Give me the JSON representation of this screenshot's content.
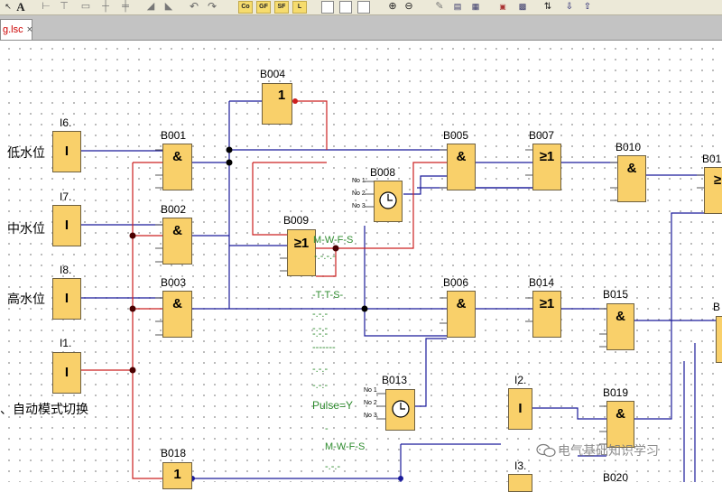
{
  "toolbar": {
    "text_label": "A",
    "co": "Co",
    "gf": "GF",
    "sf": "SF",
    "l": "L"
  },
  "tab": {
    "title": "g.lsc",
    "close": "×"
  },
  "inputs": [
    {
      "id": "I6.",
      "label": "低水位",
      "sym": "I"
    },
    {
      "id": "I7.",
      "label": "中水位",
      "sym": "I"
    },
    {
      "id": "I8.",
      "label": "高水位",
      "sym": "I"
    },
    {
      "id": "I1.",
      "label": "、自动模式切换",
      "sym": "I"
    }
  ],
  "blocks": {
    "B004": {
      "name": "B004",
      "sym": "1"
    },
    "B001": {
      "name": "B001",
      "sym": "&"
    },
    "B002": {
      "name": "B002",
      "sym": "&"
    },
    "B003": {
      "name": "B003",
      "sym": "&"
    },
    "B009": {
      "name": "B009",
      "sym": "≥1"
    },
    "B008": {
      "name": "B008"
    },
    "B005": {
      "name": "B005",
      "sym": "&"
    },
    "B007": {
      "name": "B007",
      "sym": "≥1"
    },
    "B010": {
      "name": "B010",
      "sym": "&"
    },
    "B01x": {
      "name": "B01",
      "sym": "≥"
    },
    "B006": {
      "name": "B006",
      "sym": "&"
    },
    "B014": {
      "name": "B014",
      "sym": "≥1"
    },
    "B015": {
      "name": "B015",
      "sym": "&"
    },
    "B013": {
      "name": "B013"
    },
    "I2": {
      "name": "I2.",
      "sym": "I"
    },
    "B019": {
      "name": "B019",
      "sym": "&"
    },
    "B018": {
      "name": "B018",
      "sym": "1"
    },
    "I3": {
      "name": "I3."
    },
    "B020": {
      "name": "B020"
    },
    "Bright": {
      "name": "B"
    }
  },
  "timer_pins": [
    "No 1",
    "No 2",
    "No 3"
  ],
  "annotations": {
    "mwfs1": "M-W-F-S",
    "dash1": "-.-.-.-",
    "tts": "-T-T-S-",
    "dash2": "-.-.-",
    "dash3": "-.-.-",
    "dash4": "-.-.-",
    "dash5": "-------",
    "dash6": "-.-.-",
    "dash7": "-.-.-",
    "pulse": "Pulse=Y",
    "dash8": "-",
    "mwfs2": "M-W-F-S",
    "dash9": "-.-.-"
  },
  "watermark": "电气基础知识学习",
  "colors": {
    "wire_blue": "#1a1a9a",
    "wire_red": "#cc2020",
    "block_fill": "#f9d06a",
    "annot_green": "#2e8b2e"
  }
}
